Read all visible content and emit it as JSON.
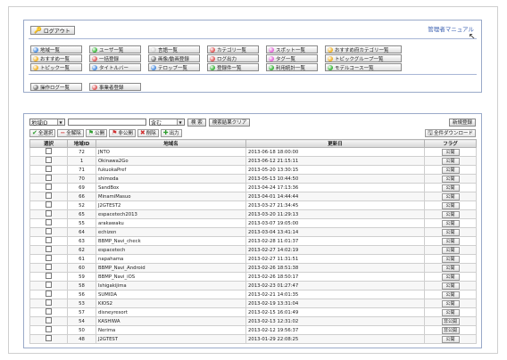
{
  "header": {
    "logout_label": "ログアウト",
    "manual_link": "管理者マニュアル"
  },
  "nav": {
    "row1": [
      {
        "label": "地域一覧",
        "color": "#4e8fe0"
      },
      {
        "label": "ユーザ一覧",
        "color": "#3fb83f"
      },
      {
        "label": "言語一覧",
        "color": "#cfcfcf"
      },
      {
        "label": "カテゴリ一覧",
        "color": "#e05c5c"
      },
      {
        "label": "スポット一覧",
        "color": "#e36ad8"
      },
      {
        "label": "おすすめ府カテゴリ一覧",
        "color": "#f0b32a"
      }
    ],
    "row2": [
      {
        "label": "おすすめ一覧",
        "color": "#f0b32a"
      },
      {
        "label": "一括登録",
        "color": "#e05c5c"
      },
      {
        "label": "画像/動画登録",
        "color": "#777777"
      },
      {
        "label": "ログ出力",
        "color": "#e05c5c"
      },
      {
        "label": "タグ一覧",
        "color": "#e36ad8"
      },
      {
        "label": "トピックグループ一覧",
        "color": "#f0b32a"
      }
    ],
    "row3": [
      {
        "label": "トピック一覧",
        "color": "#f0b32a"
      },
      {
        "label": "タイトルバー",
        "color": "#4e8fe0"
      },
      {
        "label": "テロップ一覧",
        "color": "#4e8fe0"
      },
      {
        "label": "登録件一覧",
        "color": "#3fb83f"
      },
      {
        "label": "利用統計一覧",
        "color": "#3fb83f"
      },
      {
        "label": "モデルコース一覧",
        "color": "#3fb83f"
      }
    ],
    "row4": [
      {
        "label": "操作ログ一覧",
        "color": "#777777"
      },
      {
        "label": "事業者登録",
        "color": "#e05c5c"
      }
    ]
  },
  "search": {
    "field_select": "地域ID",
    "query": "",
    "match_select": "含む",
    "search_button": "検 索",
    "clear_button": "検索結果クリア",
    "new_button": "新規登録"
  },
  "toolbar": {
    "select_all": "全選択",
    "deselect_all": "全解除",
    "publish": "公開",
    "unpublish": "非公開",
    "delete": "削除",
    "output": "出力",
    "download_all": "全件ダウンロード"
  },
  "table": {
    "headers": [
      "選択",
      "地域ID",
      "地域名",
      "更新日",
      "フラグ"
    ],
    "rows": [
      {
        "id": "72",
        "name": "JNTO",
        "date": "2013-06-18 18:00:00",
        "flag": "公開"
      },
      {
        "id": "1",
        "name": "Okinawa2Go",
        "date": "2013-06-12 21:15:11",
        "flag": "公開"
      },
      {
        "id": "71",
        "name": "fukuokaPref",
        "date": "2013-05-20 13:30:15",
        "flag": "公開"
      },
      {
        "id": "70",
        "name": "shimoda",
        "date": "2013-05-13 10:44:50",
        "flag": "公開"
      },
      {
        "id": "69",
        "name": "SandBox",
        "date": "2013-04-24 17:13:36",
        "flag": "公開"
      },
      {
        "id": "66",
        "name": "MinamiMasuo",
        "date": "2013-04-01 14:44:44",
        "flag": "公開"
      },
      {
        "id": "52",
        "name": "J2GTEST2",
        "date": "2013-03-27 21:34:45",
        "flag": "公開"
      },
      {
        "id": "65",
        "name": "espacetech2013",
        "date": "2013-03-20 11:29:13",
        "flag": "公開"
      },
      {
        "id": "55",
        "name": "arakawaku",
        "date": "2013-03-07 19:05:00",
        "flag": "公開"
      },
      {
        "id": "64",
        "name": "echizen",
        "date": "2013-03-04 13:41:14",
        "flag": "公開"
      },
      {
        "id": "63",
        "name": "BBMP_Navi_check",
        "date": "2013-02-28 11:01:37",
        "flag": "公開"
      },
      {
        "id": "62",
        "name": "espacetech",
        "date": "2013-02-27 14:02:19",
        "flag": "公開"
      },
      {
        "id": "61",
        "name": "napahama",
        "date": "2013-02-27 11:31:51",
        "flag": "公開"
      },
      {
        "id": "60",
        "name": "BBMP_Navi_Android",
        "date": "2013-02-26 18:51:38",
        "flag": "公開"
      },
      {
        "id": "59",
        "name": "BBMP_Navi_iOS",
        "date": "2013-02-26 18:50:17",
        "flag": "公開"
      },
      {
        "id": "58",
        "name": "Ishigakijima",
        "date": "2013-02-23 01:27:47",
        "flag": "公開"
      },
      {
        "id": "56",
        "name": "SUMIDA",
        "date": "2013-02-21 14:01:35",
        "flag": "公開"
      },
      {
        "id": "53",
        "name": "KIOS2",
        "date": "2013-02-19 13:31:04",
        "flag": "公開"
      },
      {
        "id": "57",
        "name": "disneyresort",
        "date": "2013-02-15 16:01:49",
        "flag": "公開"
      },
      {
        "id": "54",
        "name": "KASHIWA",
        "date": "2013-02-13 12:31:02",
        "flag": "非公開"
      },
      {
        "id": "50",
        "name": "Nerima",
        "date": "2013-02-12 19:56:37",
        "flag": "非公開"
      },
      {
        "id": "48",
        "name": "J2GTEST",
        "date": "2013-01-29 22:08:25",
        "flag": "公開"
      }
    ]
  }
}
